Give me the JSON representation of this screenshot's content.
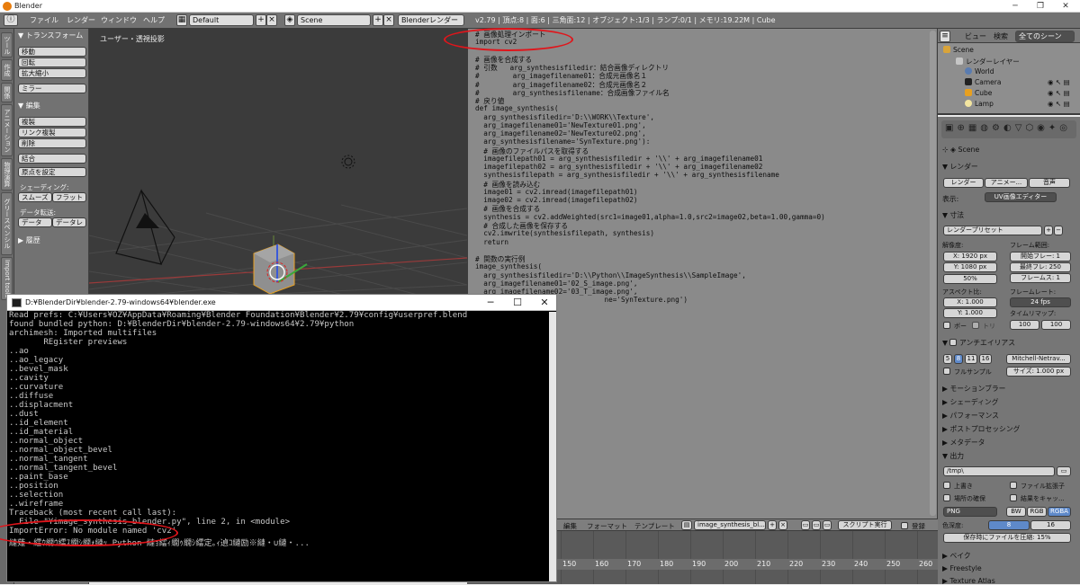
{
  "window": {
    "title": "Blender"
  },
  "infobar": {
    "menus": [
      "ファイル",
      "レンダー",
      "ウィンドウ",
      "ヘルプ"
    ],
    "layout": "Default",
    "scene": "Scene",
    "engine": "Blenderレンダー",
    "stats": "v2.79 | 頂点:8 | 面:6 | 三角面:12 | オブジェクト:1/3 | ランプ:0/1 | メモリ:19.22M | Cube"
  },
  "tool_tabs": [
    "ツール",
    "作成",
    "関係",
    "アニメーション",
    "物理演算",
    "グリースペンシル",
    "Import tools"
  ],
  "tool_shelf": {
    "transform_header": "▼ トランスフォーム",
    "transform": [
      "移動",
      "回転",
      "拡大縮小",
      "ミラー"
    ],
    "edit_header": "▼ 編集",
    "edit": [
      "複製",
      "リンク複製",
      "削除",
      "結合"
    ],
    "origin": "原点を設定",
    "shading_label": "シェーディング:",
    "shading": [
      "スムーズ",
      "フラット"
    ],
    "data_label": "データ転送:",
    "data": [
      "データ",
      "データレ"
    ],
    "history": "▶ 履歴"
  },
  "viewport": {
    "label": "ユーザー・透視投影"
  },
  "editor": {
    "lines": [
      "# 画像処理インポート",
      "import cv2",
      "",
      "# 画像を合成する",
      "# 引数   arg_synthesisfiledir：結合画像ディレクトリ",
      "#        arg_imagefilename01：合成元画像名１",
      "#        arg_imagefilename02：合成元画像名２",
      "#        arg_synthesisfilename：合成画像ファイル名",
      "# 戻り値",
      "def image_synthesis(",
      "  arg_synthesisfiledir='D:\\\\WORK\\\\Texture',",
      "  arg_imagefilename01='NewTexture01.png',",
      "  arg_imagefilename02='NewTexture02.png',",
      "  arg_synthesisfilename='SynTexture.png'):",
      "  # 画像のファイルパスを取得する",
      "  imagefilepath01 = arg_synthesisfiledir + '\\\\' + arg_imagefilename01",
      "  imagefilepath02 = arg_synthesisfiledir + '\\\\' + arg_imagefilename02",
      "  synthesisfilepath = arg_synthesisfiledir + '\\\\' + arg_synthesisfilename",
      "  # 画像を読み込む",
      "  image01 = cv2.imread(imagefilepath01)",
      "  image02 = cv2.imread(imagefilepath02)",
      "  # 画像を合成する",
      "  synthesis = cv2.addWeighted(src1=image01,alpha=1.0,src2=image02,beta=1.00,gamma=0)",
      "  # 合成した画像を保存する",
      "  cv2.imwrite(synthesisfilepath, synthesis)",
      "  return",
      "",
      "# 関数の実行例",
      "image_synthesis(",
      "  arg_synthesisfiledir='D:\\\\Python\\\\ImageSynthesis\\\\SampleImage',",
      "  arg_imagefilename01='02_S_image.png',",
      "  arg_imagefilename02='03_T_image.png',",
      "                               ne='SynTexture.png')"
    ],
    "footer": {
      "edit": "編集",
      "format": "フォーマット",
      "templates": "テンプレート",
      "file": "image_synthesis_bl...",
      "run": "スクリプト実行",
      "register": "登録"
    }
  },
  "timeline": {
    "ticks": [
      "150",
      "160",
      "170",
      "180",
      "190",
      "200",
      "210",
      "220",
      "230",
      "240",
      "250",
      "260"
    ]
  },
  "outliner": {
    "view": "ビュー",
    "search": "検索",
    "filter": "全てのシーン",
    "items": [
      "Scene",
      "レンダーレイヤー",
      "World",
      "Camera",
      "Cube",
      "Lamp"
    ]
  },
  "properties": {
    "scene": "Scene",
    "render_header": "▼ レンダー",
    "render_buttons": [
      "レンダー",
      "アニメー...",
      "音声"
    ],
    "display_label": "表示:",
    "display_value": "UV画像エディター",
    "dimensions_header": "▼ 寸法",
    "preset": "レンダープリセット",
    "resolution_label": "解像度:",
    "res_x": "X:    1920 px",
    "res_y": "Y:    1080 px",
    "res_pct": "50%",
    "frame_range_label": "フレーム範囲:",
    "frame_start": "開始フレー: 1",
    "frame_end": "最終フレ: 250",
    "frame_step": "フレームス: 1",
    "aspect_label": "アスペクト比:",
    "asp_x": "X:   1.000",
    "asp_y": "Y:   1.000",
    "framerate_label": "フレームレート:",
    "fps": "24 fps",
    "timemap_label": "タイムリマップ:",
    "timemap": [
      "100",
      "100"
    ],
    "border": "ボー",
    "crop": "トリ",
    "aa_header": "アンチエイリアス",
    "aa_samples": [
      "5",
      "8",
      "11",
      "16"
    ],
    "aa_filter": "Mitchell-Netrav...",
    "full_sample": "フルサンプル",
    "size": "サイズ: 1.000 px",
    "collapsed": [
      "▶ モーションブラー",
      "▶ シェーディング",
      "▶ パフォーマンス",
      "▶ ポストプロセッシング",
      "▶ メタデータ"
    ],
    "output_header": "▼ 出力",
    "output_path": "/tmp\\",
    "overwrite": "上書き",
    "file_ext": "ファイル拡張子",
    "placeholders": "場所の確保",
    "cache": "結果をキャッ...",
    "format": "PNG",
    "color_modes": [
      "BW",
      "RGB",
      "RGBA"
    ],
    "color_depth_label": "色深度:",
    "depths": [
      "8",
      "16"
    ],
    "compress": "保存時にファイルを圧縮:",
    "compress_val": "15%",
    "bake_header": "▶ ベイク",
    "freestyle": "▶ Freestyle",
    "atlas": "▶ Texture Atlas"
  },
  "console": {
    "title": "D:¥BlenderDir¥blender-2.79-windows64¥blender.exe",
    "lines": [
      "Read prefs: C:¥Users¥OZ¥AppData¥Roaming¥Blender Foundation¥Blender¥2.79¥config¥userpref.blend",
      "found bundled python: D:¥BlenderDir¥blender-2.79-windows64¥2.79¥python",
      "archimesh: Imported multifiles",
      "       REgister previews",
      "..ao",
      "..ao_legacy",
      "..bevel_mask",
      "..cavity",
      "..curvature",
      "..diffuse",
      "..displacment",
      "..dust",
      "..id_element",
      "..id_material",
      "..normal_object",
      "..normal_object_bevel",
      "..normal_tangent",
      "..normal_tangent_bevel",
      "..paint_base",
      "..position",
      "..selection",
      "..wireframe",
      "Traceback (most recent call last):",
      "  File \"¥image_synthesis_blender.py\", line 2, in <module>",
      "ImportError: No module named 'cv2'",
      "縺薙・繧ｳ繝ｳ繧ｽ繝ｼ繝ｫ縺ｯ Python 縺ｮ繧ｨ繝ｩ繝ｼ繧定｡ｨ遉ｺ縺励※縺・∪縺・..."
    ]
  },
  "colors": {
    "accent": "#5e89c9",
    "annotation": "#e0151b",
    "console_bg": "#000000",
    "editor_bg": "#8a8a8a"
  }
}
